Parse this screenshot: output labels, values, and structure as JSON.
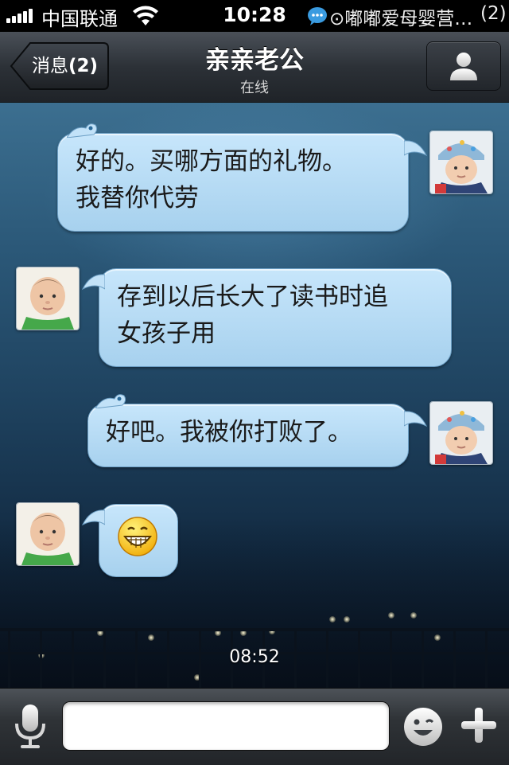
{
  "status_bar": {
    "carrier": "中国联通",
    "time": "10:28",
    "notification_text": "⊙嘟嘟爱母婴营…",
    "notification_count": "(2)",
    "signal_icon": "signal-bars-icon",
    "wifi_icon": "wifi-icon",
    "notification_icon": "chat-bubble-icon"
  },
  "nav": {
    "back_label": "消息",
    "back_count": "(2)",
    "title": "亲亲老公",
    "subtitle": "在线",
    "profile_icon": "person-icon"
  },
  "messages": [
    {
      "side": "right",
      "text": "好的。买哪方面的礼物。\n我替你代劳",
      "avatar": "baby-with-hat"
    },
    {
      "side": "left",
      "text": "存到以后长大了读书时追\n女孩子用",
      "avatar": "baby-green-shirt"
    },
    {
      "side": "right",
      "text": "好吧。我被你打败了。",
      "avatar": "baby-with-hat"
    },
    {
      "side": "left",
      "emoji": "grinning-face-emoji",
      "avatar": "baby-green-shirt"
    }
  ],
  "timestamp": "08:52",
  "input": {
    "value": "",
    "placeholder": "",
    "mic_icon": "microphone-icon",
    "emoji_icon": "smiley-icon",
    "plus_icon": "plus-icon"
  },
  "colors": {
    "bubble": "#b9ddf5",
    "bubble_border": "#6c9fc5",
    "nav_bar": "#2c3137"
  }
}
